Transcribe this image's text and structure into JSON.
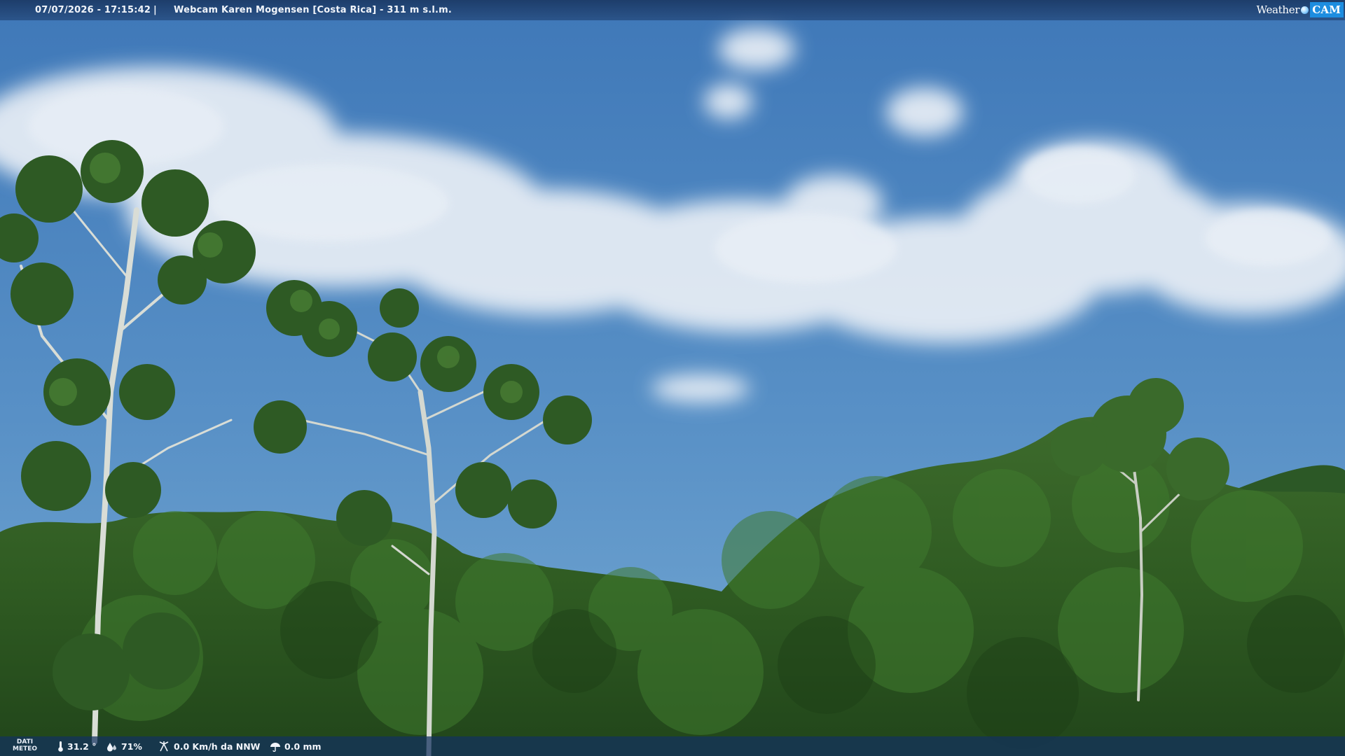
{
  "overlay": {
    "timestamp": "07/07/2026 - 17:15:42",
    "separator": "|",
    "title": "Webcam Karen Mogensen [Costa Rica]  - 311 m s.l.m."
  },
  "logo": {
    "weather": "Weather",
    "cam": "CAM"
  },
  "meteo": {
    "label_line1": "DATI",
    "label_line2": "METEO",
    "temperature": "31.2 °",
    "humidity": "71%",
    "wind": "0.0 Km/h da NNW",
    "rain": "0.0 mm"
  },
  "icons": {
    "temperature": "thermometer-icon",
    "humidity": "droplet-icon",
    "wind": "wind-icon",
    "rain": "umbrella-icon"
  },
  "colors": {
    "sky_top": "#3f78b8",
    "sky_bottom": "#6da2cf",
    "foliage": "#2d5a22",
    "overlay_bar": "#1a3d70",
    "logo_blue": "#1d8de0"
  }
}
